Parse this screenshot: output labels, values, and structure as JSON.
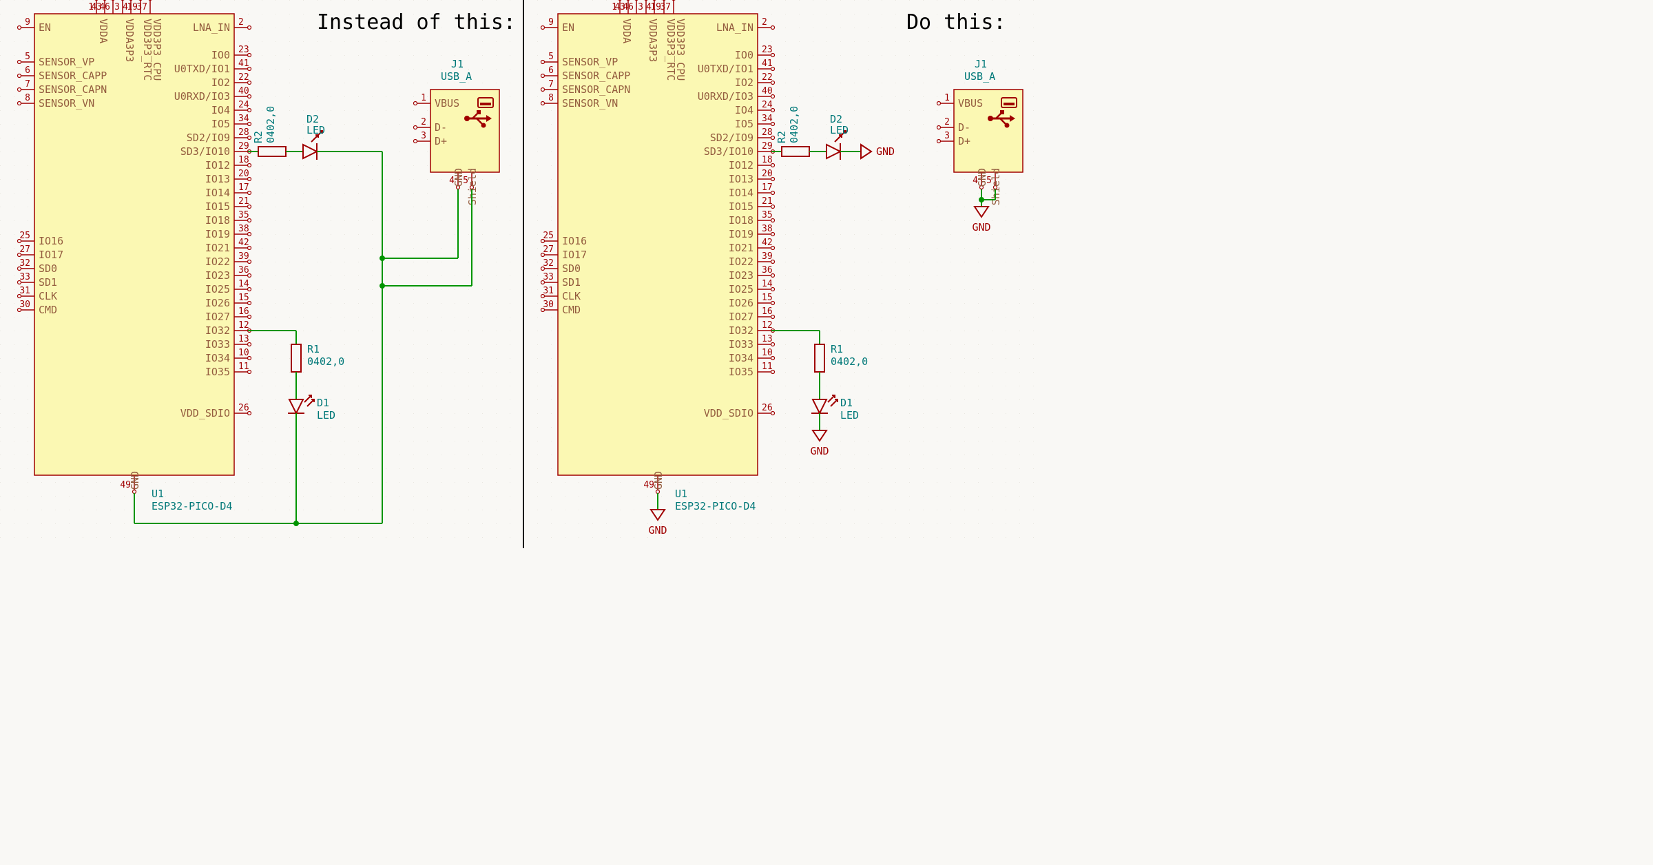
{
  "titles": {
    "left": "Instead of this:",
    "right": "Do this:"
  },
  "chip": {
    "ref": "U1",
    "value": "ESP32-PICO-D4",
    "left_pins": [
      {
        "num": "9",
        "name": "EN"
      },
      {
        "num": "5",
        "name": "SENSOR_VP"
      },
      {
        "num": "6",
        "name": "SENSOR_CAPP"
      },
      {
        "num": "7",
        "name": "SENSOR_CAPN"
      },
      {
        "num": "8",
        "name": "SENSOR_VN"
      },
      {
        "num": "25",
        "name": "IO16"
      },
      {
        "num": "27",
        "name": "IO17"
      },
      {
        "num": "32",
        "name": "SD0"
      },
      {
        "num": "33",
        "name": "SD1"
      },
      {
        "num": "31",
        "name": "CLK"
      },
      {
        "num": "30",
        "name": "CMD"
      }
    ],
    "right_pins": [
      {
        "num": "2",
        "name": "LNA_IN"
      },
      {
        "num": "23",
        "name": "IO0"
      },
      {
        "num": "41",
        "name": "U0TXD/IO1"
      },
      {
        "num": "22",
        "name": "IO2"
      },
      {
        "num": "40",
        "name": "U0RXD/IO3"
      },
      {
        "num": "24",
        "name": "IO4"
      },
      {
        "num": "34",
        "name": "IO5"
      },
      {
        "num": "28",
        "name": "SD2/IO9"
      },
      {
        "num": "29",
        "name": "SD3/IO10"
      },
      {
        "num": "18",
        "name": "IO12"
      },
      {
        "num": "20",
        "name": "IO13"
      },
      {
        "num": "17",
        "name": "IO14"
      },
      {
        "num": "21",
        "name": "IO15"
      },
      {
        "num": "35",
        "name": "IO18"
      },
      {
        "num": "38",
        "name": "IO19"
      },
      {
        "num": "42",
        "name": "IO21"
      },
      {
        "num": "39",
        "name": "IO22"
      },
      {
        "num": "36",
        "name": "IO23"
      },
      {
        "num": "14",
        "name": "IO25"
      },
      {
        "num": "15",
        "name": "IO26"
      },
      {
        "num": "16",
        "name": "IO27"
      },
      {
        "num": "12",
        "name": "IO32"
      },
      {
        "num": "13",
        "name": "IO33"
      },
      {
        "num": "10",
        "name": "IO34"
      },
      {
        "num": "11",
        "name": "IO35"
      },
      {
        "num": "26",
        "name": "VDD_SDIO"
      }
    ],
    "top_pins": [
      {
        "num": "1",
        "name": "VDDA"
      },
      {
        "num": "43",
        "name": "VDDA"
      },
      {
        "num": "46",
        "name": "VDDA"
      },
      {
        "num": "3",
        "name": "VDDA3P3"
      },
      {
        "num": "4",
        "name": "VDDA3P3"
      },
      {
        "num": "19",
        "name": "VDD3P3_RTC"
      },
      {
        "num": "37",
        "name": "VDD3P3_CPU"
      }
    ],
    "bottom_pin": {
      "num": "49",
      "name": "GND"
    }
  },
  "usb": {
    "ref": "J1",
    "value": "USB_A",
    "pins": [
      {
        "num": "1",
        "name": "VBUS"
      },
      {
        "num": "2",
        "name": "D-"
      },
      {
        "num": "3",
        "name": "D+"
      },
      {
        "num": "4",
        "name": "GND"
      },
      {
        "num": "5",
        "name": "Shield"
      }
    ]
  },
  "components": {
    "R1": {
      "ref": "R1",
      "value": "0402,0"
    },
    "R2": {
      "ref": "R2",
      "value": "0402,0"
    },
    "D1": {
      "ref": "D1",
      "value": "LED"
    },
    "D2": {
      "ref": "D2",
      "value": "LED"
    }
  },
  "power_label": "GND"
}
